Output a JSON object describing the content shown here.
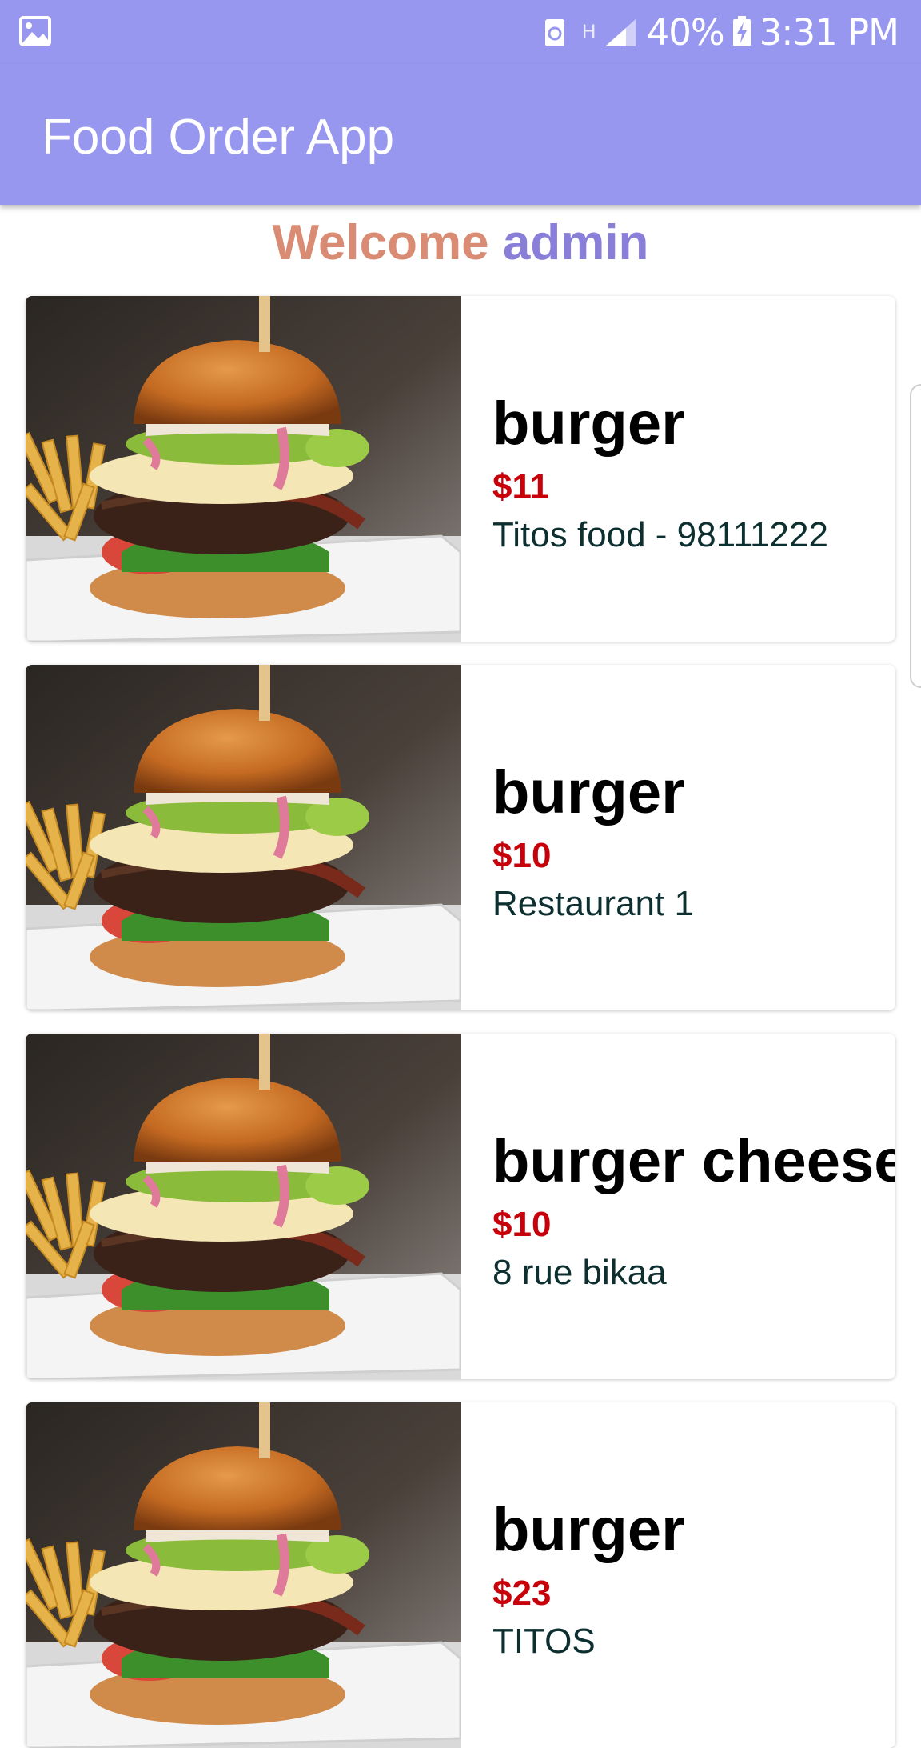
{
  "status_bar": {
    "battery": "40%",
    "time": "3:31 PM",
    "network": "H",
    "icons": [
      "gallery-icon",
      "sync-icon",
      "network-h-icon",
      "signal-icon",
      "battery-charging-icon"
    ]
  },
  "app_bar": {
    "title": "Food Order App"
  },
  "welcome": {
    "prefix": "Welcome ",
    "username": "admin"
  },
  "colors": {
    "primary": "#9797ef",
    "welcome_prefix": "#d98b73",
    "welcome_user": "#8a7fd8",
    "price": "#c8000a"
  },
  "items": [
    {
      "name": "burger",
      "price": "$11",
      "restaurant": "Titos food - 98111222",
      "image": "burger-photo"
    },
    {
      "name": "burger",
      "price": "$10",
      "restaurant": "Restaurant 1",
      "image": "burger-photo"
    },
    {
      "name": "burger cheese",
      "price": "$10",
      "restaurant": "8 rue bikaa",
      "image": "burger-photo"
    },
    {
      "name": "burger",
      "price": "$23",
      "restaurant": "TITOS",
      "image": "burger-photo"
    }
  ]
}
